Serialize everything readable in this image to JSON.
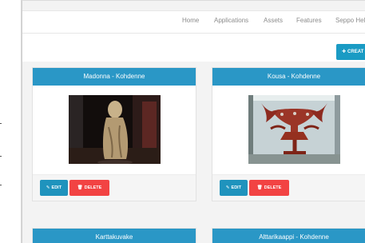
{
  "navbar": {
    "links": [
      "Home",
      "Applications",
      "Assets",
      "Features",
      "Seppo Hel"
    ]
  },
  "toolbar": {
    "create_label": "CREAT",
    "create_icon": "plus-icon"
  },
  "cards": [
    {
      "title": "Madonna - Kohdenne",
      "edit_label": "EDIT",
      "delete_label": "DELETE",
      "image_subject": "wooden-madonna-figure"
    },
    {
      "title": "Kousa - Kohdenne",
      "edit_label": "EDIT",
      "delete_label": "DELETE",
      "image_subject": "carved-wooden-cup"
    },
    {
      "title": "Karttakuvake"
    },
    {
      "title": "Alttarikaappi - Kohdenne"
    }
  ],
  "colors": {
    "accent": "#2a97c6",
    "delete": "#f24343",
    "edit": "#1f93bd"
  }
}
